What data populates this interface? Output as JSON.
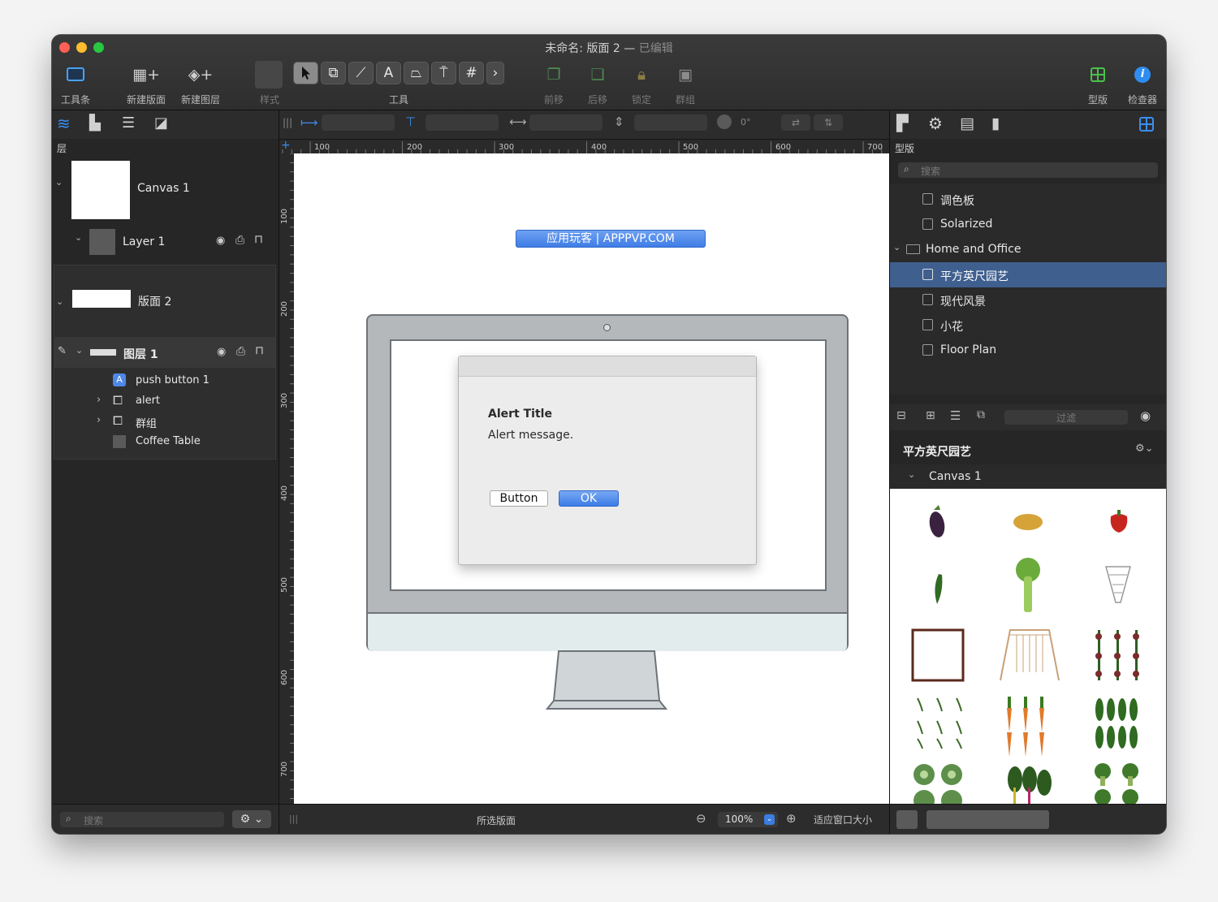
{
  "window": {
    "title": "未命名: 版面 2 —",
    "title_status": "已编辑"
  },
  "toolbar": {
    "toolbar_label": "工具条",
    "new_canvas_label": "新建版面",
    "new_layer_label": "新建图层",
    "style_label": "样式",
    "tools_label": "工具",
    "front_label": "前移",
    "back_label": "后移",
    "lock_label": "锁定",
    "group_label": "群组",
    "stencils_label": "型版",
    "inspector_label": "检查器"
  },
  "layers_panel": {
    "header": "层",
    "items": [
      {
        "label": "Canvas 1"
      },
      {
        "label": "Layer 1"
      },
      {
        "label": "版面 2"
      },
      {
        "label": "图层 1"
      },
      {
        "label": "push button 1"
      },
      {
        "label": "alert"
      },
      {
        "label": "群组"
      },
      {
        "label": "Coffee Table"
      }
    ],
    "search_placeholder": "搜索"
  },
  "ruler": {
    "h_ticks": [
      "100",
      "200",
      "300",
      "400",
      "500",
      "600",
      "700"
    ],
    "v_ticks": [
      "100",
      "200",
      "300",
      "400",
      "500",
      "600",
      "700"
    ],
    "rotation": "0°"
  },
  "canvas": {
    "banner": "应用玩客 | APPPVP.COM",
    "alert_title": "Alert Title",
    "alert_message": "Alert message.",
    "button_label": "Button",
    "ok_label": "OK"
  },
  "status_bar": {
    "selection": "所选版面",
    "zoom": "100%",
    "fit": "适应窗口大小"
  },
  "stencils_panel": {
    "header": "型版",
    "search_placeholder": "搜索",
    "items": [
      {
        "label": "调色板"
      },
      {
        "label": "Solarized"
      },
      {
        "label": "Home and Office"
      },
      {
        "label": "平方英尺园艺"
      },
      {
        "label": "现代风景"
      },
      {
        "label": "小花"
      },
      {
        "label": "Floor Plan"
      }
    ],
    "filter_placeholder": "过滤",
    "current_title": "平方英尺园艺",
    "current_canvas": "Canvas 1"
  },
  "colors": {
    "accent": "#3b7de0",
    "selection": "#3f5f8f",
    "banner": "#4a84e8"
  }
}
